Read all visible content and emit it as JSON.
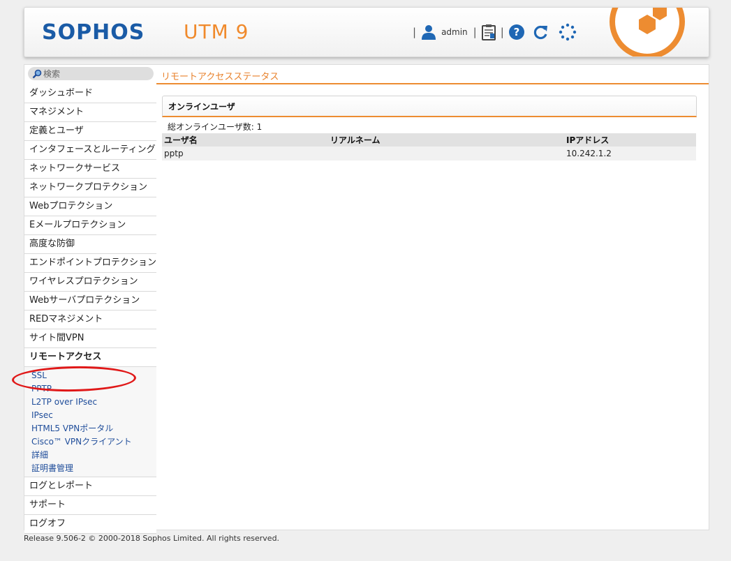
{
  "header": {
    "brand": "SOPHOS",
    "product": "UTM 9",
    "user": "admin",
    "icons": [
      "user-icon",
      "clipboard-icon",
      "help-icon",
      "reload-icon",
      "loading-icon"
    ],
    "accent_color": "#ed8c31",
    "brand_color": "#1a5ba6"
  },
  "search": {
    "placeholder": "検索"
  },
  "page": {
    "title": "リモートアクセスステータス"
  },
  "sidebar": {
    "items_top": [
      "ダッシュボード",
      "マネジメント",
      "定義とユーザ",
      "インタフェースとルーティング",
      "ネットワークサービス",
      "ネットワークプロテクション",
      "Webプロテクション",
      "Eメールプロテクション",
      "高度な防御",
      "エンドポイントプロテクション",
      "ワイヤレスプロテクション",
      "Webサーバプロテクション",
      "REDマネジメント",
      "サイト間VPN"
    ],
    "active": "リモートアクセス",
    "subitems": [
      "SSL",
      "PPTP",
      "L2TP over IPsec",
      "IPsec",
      "HTML5 VPNポータル",
      "Cisco™ VPNクライアント",
      "詳細",
      "証明書管理"
    ],
    "items_bottom": [
      "ログとレポート",
      "サポート",
      "ログオフ"
    ]
  },
  "online_users": {
    "title": "オンラインユーザ",
    "count_line": "総オンラインユーザ数: 1",
    "columns": [
      "ユーザ名",
      "リアルネーム",
      "IPアドレス"
    ],
    "rows": [
      [
        "pptp",
        "",
        "10.242.1.2"
      ]
    ]
  },
  "footer": {
    "text": "Release 9.506-2  © 2000-2018 Sophos Limited. All rights reserved."
  }
}
